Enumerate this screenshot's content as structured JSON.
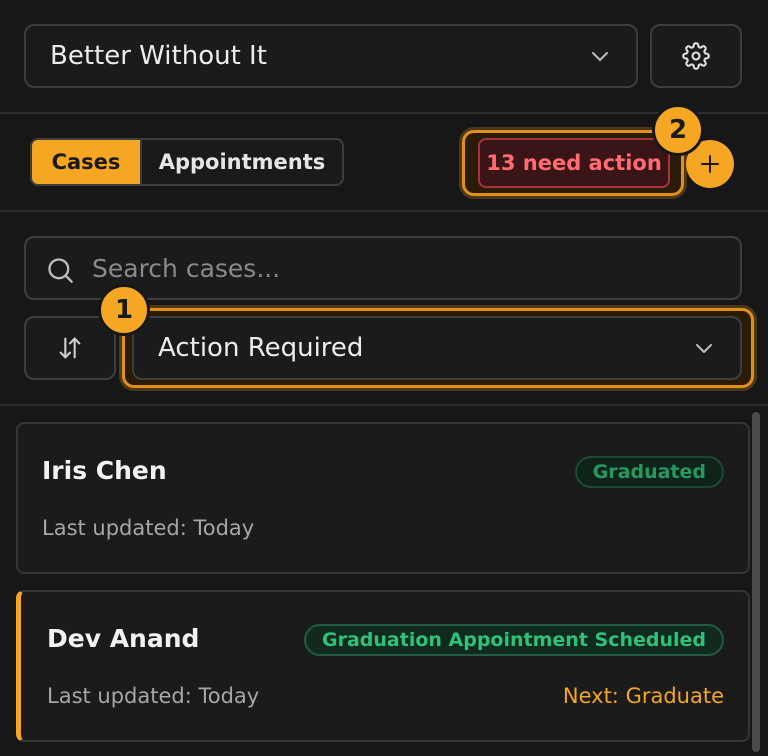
{
  "workspace": {
    "selected": "Better Without It"
  },
  "tabs": {
    "cases_label": "Cases",
    "appointments_label": "Appointments",
    "active": "Cases"
  },
  "needs_action": {
    "label": "13 need action"
  },
  "callouts": {
    "one": "1",
    "two": "2"
  },
  "search": {
    "placeholder": "Search cases..."
  },
  "filter": {
    "selected": "Action Required"
  },
  "cases": [
    {
      "name": "Iris Chen",
      "status": "Graduated",
      "updated": "Last updated: Today",
      "next": ""
    },
    {
      "name": "Dev Anand",
      "status": "Graduation Appointment Scheduled",
      "updated": "Last updated: Today",
      "next": "Next: Graduate"
    }
  ],
  "colors": {
    "accent": "#f5a623",
    "danger": "#ff6b70",
    "success": "#2cc27a",
    "background": "#171717"
  }
}
